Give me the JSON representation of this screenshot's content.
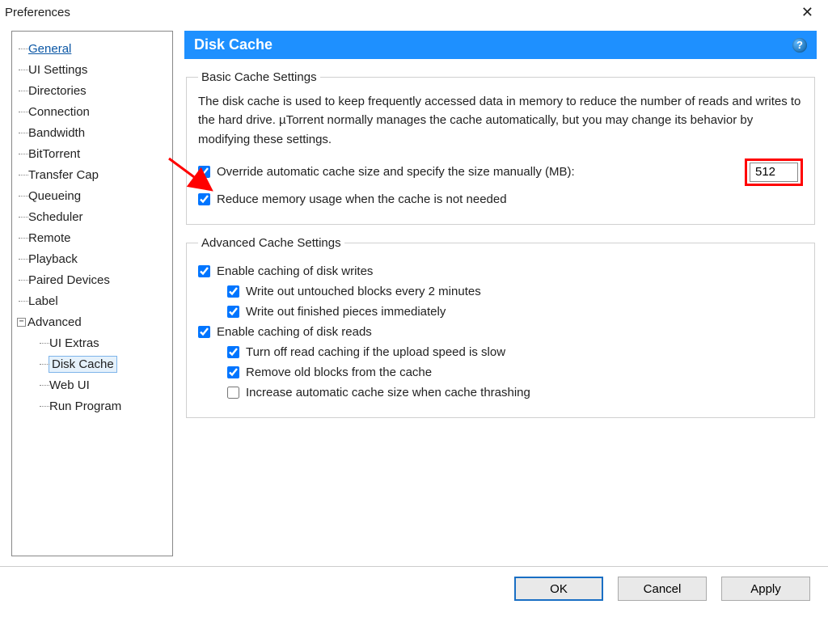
{
  "window": {
    "title": "Preferences"
  },
  "tree": {
    "items": [
      "General",
      "UI Settings",
      "Directories",
      "Connection",
      "Bandwidth",
      "BitTorrent",
      "Transfer Cap",
      "Queueing",
      "Scheduler",
      "Remote",
      "Playback",
      "Paired Devices",
      "Label",
      "Advanced"
    ],
    "advanced_children": [
      "UI Extras",
      "Disk Cache",
      "Web UI",
      "Run Program"
    ]
  },
  "header": {
    "title": "Disk Cache"
  },
  "basic": {
    "legend": "Basic Cache Settings",
    "description": "The disk cache is used to keep frequently accessed data in memory to reduce the number of reads and writes to the hard drive. µTorrent normally manages the cache automatically, but you may change its behavior by modifying these settings.",
    "override_label": "Override automatic cache size and specify the size manually (MB):",
    "override_value": "512",
    "reduce_label": "Reduce memory usage when the cache is not needed"
  },
  "advanced": {
    "legend": "Advanced Cache Settings",
    "enable_writes": "Enable caching of disk writes",
    "write_untouched": "Write out untouched blocks every 2 minutes",
    "write_finished": "Write out finished pieces immediately",
    "enable_reads": "Enable caching of disk reads",
    "turn_off_read": "Turn off read caching if the upload speed is slow",
    "remove_old": "Remove old blocks from the cache",
    "increase_auto": "Increase automatic cache size when cache thrashing"
  },
  "buttons": {
    "ok": "OK",
    "cancel": "Cancel",
    "apply": "Apply"
  }
}
